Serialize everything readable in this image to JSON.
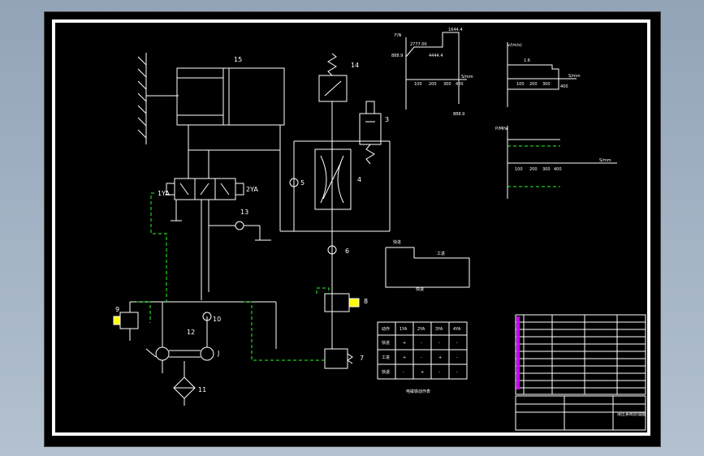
{
  "labels": {
    "cylinder": "15",
    "switch": "14",
    "valve_3": "3",
    "throttle": "4",
    "gauge": "5",
    "check_6": "6",
    "valve_8": "8",
    "valve_7": "7",
    "relief": "9",
    "check_10": "10",
    "pump": "12",
    "motor": "J",
    "filter": "11",
    "check_13": "13",
    "sol_left": "1YA",
    "sol_right": "2YA"
  },
  "graphs": {
    "g1_ylabel": "F/N",
    "g1_top_value": "1644.4",
    "g1_low_left": "888.9",
    "g1_mid": "2777.00",
    "g1_mid2": "4444.4",
    "g1_low_right": "888.9",
    "g1_ticks": [
      "100",
      "200",
      "300",
      "400"
    ],
    "g1_xlabel": "S/mm",
    "g2_ylabel": "v/(m/s)",
    "g2_value": "1.6",
    "g2_ticks": [
      "100",
      "200",
      "300",
      "400"
    ],
    "g2_xlabel": "S/mm",
    "g3_ylabel": "P/MPa",
    "g3_ticks": [
      "100",
      "200",
      "300",
      "400"
    ],
    "g3_xlabel": "S/mm"
  },
  "cycle_labels": {
    "fast": "快进",
    "work": "工进",
    "back": "快退"
  },
  "action_table": {
    "headers": [
      "动作",
      "1YA",
      "2YA",
      "3YA",
      "4YA"
    ],
    "rows": [
      [
        "快进",
        "+",
        "-",
        "-",
        "-"
      ],
      [
        "工进",
        "+",
        "-",
        "+",
        "-"
      ],
      [
        "快退",
        "-",
        "+",
        "-",
        "-"
      ]
    ],
    "caption": "电磁铁动作表"
  },
  "title_block": {
    "drawing_title": "液压系统原理图"
  }
}
